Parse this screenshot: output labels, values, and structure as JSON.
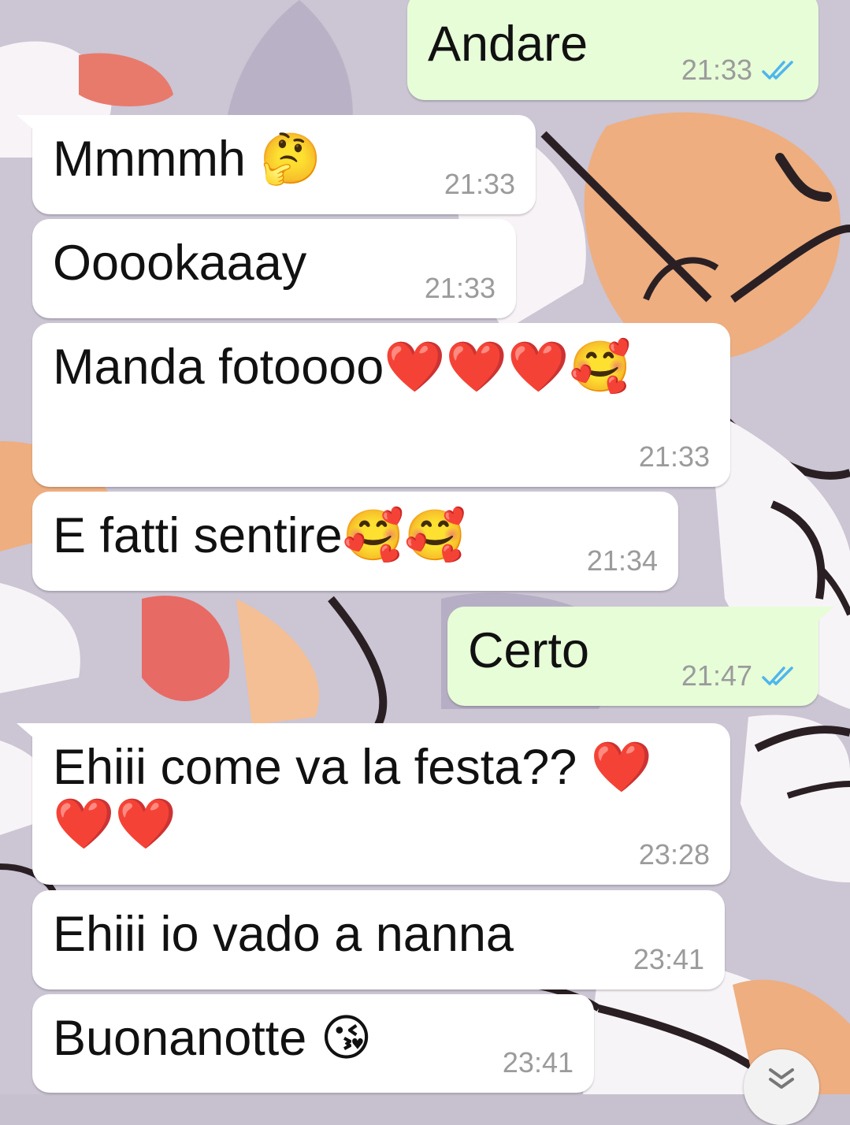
{
  "messages": [
    {
      "direction": "out",
      "text": "Andare",
      "time": "21:33",
      "read_status": "double-check-read",
      "tail": false
    },
    {
      "direction": "in",
      "text": "Mmmmh 🤔",
      "time": "21:33",
      "tail": true
    },
    {
      "direction": "in",
      "text": "Ooookaaay",
      "time": "21:33",
      "tail": false
    },
    {
      "direction": "in",
      "text": "Manda fotoooo❤️❤️❤️🥰",
      "time": "21:33",
      "tail": false
    },
    {
      "direction": "in",
      "text": "E fatti sentire🥰🥰",
      "time": "21:34",
      "tail": false
    },
    {
      "direction": "out",
      "text": "Certo",
      "time": "21:47",
      "read_status": "double-check-read",
      "tail": true
    },
    {
      "direction": "in",
      "text": "Ehiii come va la festa?? ❤️\n❤️❤️",
      "time": "23:28",
      "tail": true
    },
    {
      "direction": "in",
      "text": "Ehiii io vado a nanna",
      "time": "23:41",
      "tail": false
    },
    {
      "direction": "in",
      "text": "Buonanotte 😘",
      "time": "23:41",
      "tail": false
    }
  ],
  "scroll_button": {
    "icon": "double-chevron-down-icon"
  },
  "colors": {
    "incoming_bubble": "#ffffff",
    "outgoing_bubble": "#e7fdd8",
    "timestamp": "#9b9b9b",
    "read_ticks": "#4fb6ec",
    "wallpaper_base": "#c7c1cf"
  }
}
